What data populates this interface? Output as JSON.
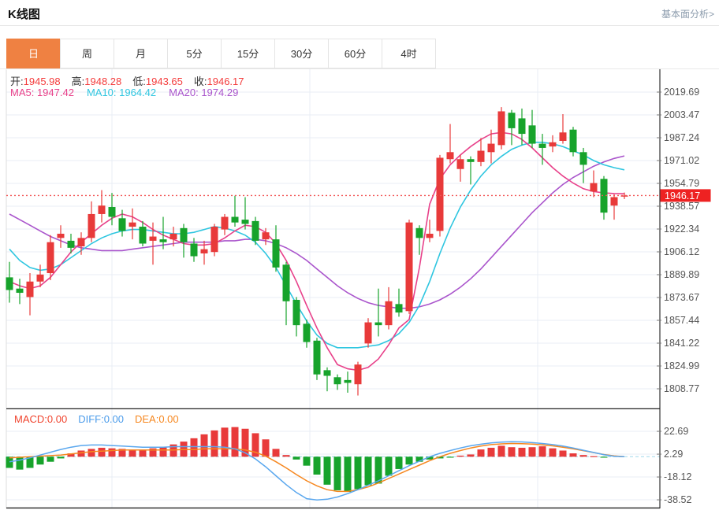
{
  "page": {
    "title": "K线图",
    "link": "基本面分析>"
  },
  "tabs": {
    "items": [
      "日",
      "周",
      "月",
      "5分",
      "15分",
      "30分",
      "60分",
      "4时"
    ],
    "active_index": 0
  },
  "ohlc": {
    "pairs": [
      {
        "label": "开:",
        "value": "1945.98"
      },
      {
        "label": "高:",
        "value": "1948.28"
      },
      {
        "label": "低:",
        "value": "1943.65"
      },
      {
        "label": "收:",
        "value": "1946.17"
      }
    ]
  },
  "ma_legend": {
    "ma5": "MA5: 1947.42",
    "ma10": "MA10: 1964.42",
    "ma20": "MA20: 1974.29"
  },
  "macd_legend": {
    "macd": "MACD:0.00",
    "diff": "DIFF:0.00",
    "dea": "DEA:0.00"
  },
  "current_price": "1946.17",
  "price_axis_ticks": [
    "2019.69",
    "2003.47",
    "1987.24",
    "1971.02",
    "1954.79",
    "1938.57",
    "1922.34",
    "1906.12",
    "1889.89",
    "1873.67",
    "1857.44",
    "1841.22",
    "1824.99",
    "1808.77"
  ],
  "macd_axis_ticks": [
    "22.69",
    "2.29",
    "-18.12",
    "-38.52"
  ],
  "colors": {
    "up_red": "#e83a3a",
    "down_green": "#17a32b",
    "ma5_pink": "#e8418a",
    "ma10_cyan": "#2fc6e0",
    "ma20_purple": "#aa55cc",
    "diff_blue": "#5aa7ee",
    "dea_orange": "#f6871f",
    "active_tab_orange": "#ef8142",
    "price_badge_red": "#ee2222",
    "dotted_line_red": "#f25555",
    "grid": "#e9eef4",
    "axis_text": "#555",
    "axis_line": "#333",
    "zero_dash_cyan": "#9fd8ea"
  },
  "chart_data": {
    "type": "candlestick+macd",
    "title": "K线图 日线 (daily K-line with MA5/MA10/MA20 and MACD)",
    "main": {
      "yticks": [
        2019.69,
        2003.47,
        1987.24,
        1971.02,
        1954.79,
        1938.57,
        1922.34,
        1906.12,
        1889.89,
        1873.67,
        1857.44,
        1841.22,
        1824.99,
        1808.77
      ],
      "current_price": 1946.17,
      "last_candle": {
        "open": 1945.98,
        "high": 1948.28,
        "low": 1943.65,
        "close": 1946.17
      },
      "ma5_last": 1947.42,
      "ma10_last": 1964.42,
      "ma20_last": 1974.29,
      "candles_ohlc": [
        [
          1888,
          1899,
          1870,
          1879
        ],
        [
          1880,
          1887,
          1869,
          1877
        ],
        [
          1874,
          1891,
          1861,
          1885
        ],
        [
          1885,
          1897,
          1881,
          1890
        ],
        [
          1891,
          1918,
          1886,
          1913
        ],
        [
          1916,
          1925,
          1909,
          1919
        ],
        [
          1914,
          1919,
          1905,
          1909
        ],
        [
          1910,
          1920,
          1904,
          1916
        ],
        [
          1916,
          1942,
          1913,
          1933
        ],
        [
          1933,
          1950,
          1927,
          1939
        ],
        [
          1938,
          1948,
          1925,
          1931
        ],
        [
          1930,
          1936,
          1917,
          1921
        ],
        [
          1924,
          1937,
          1915,
          1927
        ],
        [
          1924,
          1928,
          1910,
          1912
        ],
        [
          1914,
          1927,
          1897,
          1917
        ],
        [
          1915,
          1931,
          1908,
          1913
        ],
        [
          1915,
          1924,
          1910,
          1919
        ],
        [
          1923,
          1926,
          1902,
          1913
        ],
        [
          1912,
          1916,
          1899,
          1903
        ],
        [
          1905,
          1914,
          1897,
          1908
        ],
        [
          1906,
          1926,
          1903,
          1924
        ],
        [
          1922,
          1933,
          1918,
          1931
        ],
        [
          1931,
          1946,
          1924,
          1927
        ],
        [
          1929,
          1945,
          1922,
          1926
        ],
        [
          1928,
          1931,
          1911,
          1914
        ],
        [
          1915,
          1923,
          1911,
          1920
        ],
        [
          1915,
          1925,
          1892,
          1895
        ],
        [
          1897,
          1899,
          1854,
          1871
        ],
        [
          1872,
          1874,
          1846,
          1854
        ],
        [
          1855,
          1858,
          1838,
          1842
        ],
        [
          1843,
          1845,
          1815,
          1819
        ],
        [
          1822,
          1824,
          1807,
          1818
        ],
        [
          1817,
          1819,
          1808,
          1812
        ],
        [
          1815,
          1821,
          1806,
          1813
        ],
        [
          1812,
          1828,
          1804,
          1826
        ],
        [
          1841,
          1859,
          1838,
          1856
        ],
        [
          1856,
          1880,
          1846,
          1854
        ],
        [
          1854,
          1881,
          1851,
          1871
        ],
        [
          1869,
          1880,
          1860,
          1863
        ],
        [
          1864,
          1929,
          1862,
          1927
        ],
        [
          1923,
          1925,
          1904,
          1916
        ],
        [
          1916,
          1929,
          1913,
          1919
        ],
        [
          1921,
          1975,
          1917,
          1973
        ],
        [
          1972,
          1997,
          1969,
          1977
        ],
        [
          1965,
          1975,
          1956,
          1972
        ],
        [
          1972,
          1974,
          1954,
          1970
        ],
        [
          1970,
          1987,
          1967,
          1978
        ],
        [
          1977,
          1993,
          1969,
          1983
        ],
        [
          1982,
          2009,
          1979,
          2006
        ],
        [
          2005,
          2007,
          1982,
          1994
        ],
        [
          2001,
          2008,
          1982,
          1990
        ],
        [
          1996,
          2007,
          1980,
          1983
        ],
        [
          1983,
          1990,
          1968,
          1980
        ],
        [
          1981,
          1989,
          1977,
          1984
        ],
        [
          1985,
          2004,
          1983,
          1991
        ],
        [
          1993,
          1995,
          1974,
          1977
        ],
        [
          1977,
          1980,
          1955,
          1968
        ],
        [
          1949,
          1964,
          1945,
          1955
        ],
        [
          1958,
          1960,
          1929,
          1934
        ],
        [
          1939,
          1947,
          1929,
          1945
        ],
        [
          1945.98,
          1948.28,
          1943.65,
          1946.17
        ]
      ],
      "ma5": [
        1885,
        1882,
        1880,
        1882,
        1888,
        1897,
        1906,
        1913,
        1919,
        1925,
        1930,
        1933,
        1931,
        1927,
        1922,
        1918,
        1915,
        1912,
        1911,
        1911,
        1912,
        1916,
        1921,
        1925,
        1924,
        1920,
        1912,
        1900,
        1885,
        1868,
        1852,
        1838,
        1826,
        1823,
        1822,
        1824,
        1830,
        1840,
        1852,
        1858,
        1895,
        1940,
        1958,
        1968,
        1975,
        1981,
        1986,
        1990,
        1991,
        1990,
        1986,
        1980,
        1973,
        1966,
        1960,
        1955,
        1951,
        1949,
        1948,
        1947.6,
        1947.42
      ],
      "ma10": [
        1908,
        1900,
        1895,
        1893,
        1894,
        1897,
        1902,
        1907,
        1912,
        1916,
        1919,
        1921,
        1922,
        1922,
        1921,
        1920,
        1919,
        1919,
        1920,
        1922,
        1924,
        1923,
        1921,
        1918,
        1913,
        1905,
        1895,
        1882,
        1869,
        1857,
        1847,
        1841,
        1838,
        1838,
        1838,
        1839,
        1840,
        1843,
        1848,
        1856,
        1868,
        1885,
        1905,
        1923,
        1938,
        1950,
        1960,
        1968,
        1974,
        1979,
        1982,
        1984,
        1984,
        1983,
        1981,
        1978,
        1975,
        1971,
        1968,
        1966,
        1964.42
      ],
      "ma20": [
        1933,
        1929,
        1925,
        1921,
        1917,
        1914,
        1911,
        1909,
        1908,
        1907,
        1907,
        1907,
        1908,
        1909,
        1910,
        1911,
        1912,
        1913,
        1913,
        1913,
        1913,
        1914,
        1914,
        1915,
        1915,
        1914,
        1912,
        1909,
        1905,
        1900,
        1894,
        1888,
        1882,
        1877,
        1873,
        1870,
        1868,
        1867,
        1866,
        1866,
        1867,
        1869,
        1872,
        1876,
        1881,
        1887,
        1894,
        1902,
        1910,
        1918,
        1926,
        1934,
        1941,
        1948,
        1954,
        1959,
        1963,
        1967,
        1970,
        1972.5,
        1974.29
      ]
    },
    "macd": {
      "yticks": [
        22.69,
        2.29,
        -18.12,
        -38.52
      ],
      "last": {
        "macd": 0.0,
        "diff": 0.0,
        "dea": 0.0
      },
      "bars": [
        -10,
        -11.5,
        -10,
        -7,
        -4.5,
        -1.5,
        3,
        5.5,
        7,
        8,
        7.5,
        7,
        6.5,
        6.5,
        7.5,
        9,
        11,
        13.5,
        16.5,
        20,
        23.5,
        26,
        26.5,
        25,
        21,
        15.5,
        7,
        1.5,
        -2.5,
        -8,
        -16,
        -25,
        -30,
        -31.5,
        -29,
        -25.5,
        -24,
        -17,
        -11,
        -7,
        -4.5,
        -2.5,
        -1.5,
        -0.8,
        1,
        2,
        6.5,
        8,
        9.8,
        8.5,
        8,
        8.5,
        9.3,
        7.5,
        5.5,
        3,
        1.5,
        0.5,
        -0.8,
        0,
        0
      ],
      "diff": [
        -4.5,
        -3,
        -1,
        1.5,
        4,
        6.5,
        8.5,
        10,
        10.5,
        10.5,
        10,
        9.5,
        9,
        8.5,
        8.5,
        8.5,
        9,
        9,
        9,
        9,
        9,
        8.5,
        7,
        3.5,
        -2,
        -9,
        -17,
        -25,
        -32,
        -37.5,
        -38.7,
        -38,
        -36,
        -33,
        -29.5,
        -25.5,
        -21.5,
        -17,
        -12.5,
        -8,
        -4,
        0,
        3,
        5.5,
        7.8,
        9.8,
        11.2,
        12.3,
        13,
        13.4,
        13.2,
        12.6,
        11.8,
        10.8,
        9.5,
        7.8,
        5.8,
        3.8,
        1.8,
        0.4,
        0
      ],
      "dea": [
        -1,
        -0.5,
        0,
        0.5,
        1,
        1.5,
        2.5,
        3.5,
        4.5,
        5,
        5.5,
        6,
        6,
        6,
        6,
        6,
        6,
        6.5,
        6.5,
        7,
        7,
        7,
        7,
        6,
        4,
        0.5,
        -4.5,
        -10,
        -16,
        -21.5,
        -26,
        -29.5,
        -31,
        -31,
        -29.5,
        -27,
        -23.5,
        -19.5,
        -15.5,
        -11.5,
        -7.5,
        -3.5,
        0,
        3,
        5.5,
        7.8,
        9.5,
        10.8,
        11.5,
        11.8,
        11.7,
        11.3,
        10.6,
        9.7,
        8.5,
        7,
        5.4,
        3.7,
        2,
        0.7,
        0
      ]
    }
  }
}
